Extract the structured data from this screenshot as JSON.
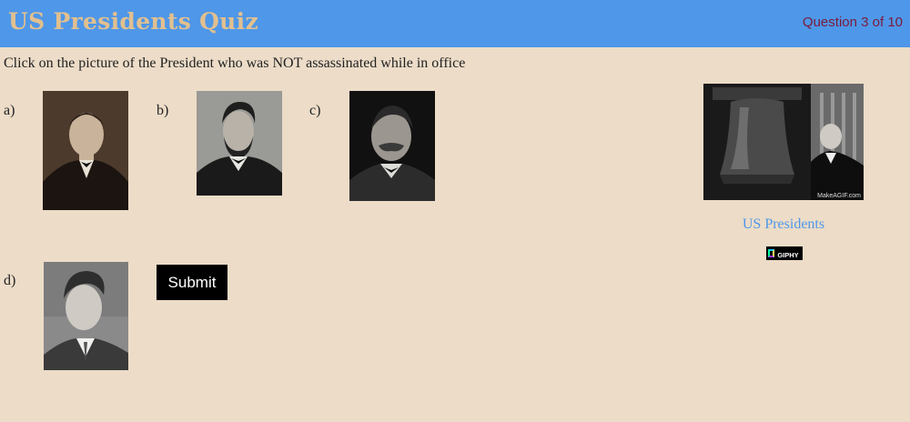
{
  "header": {
    "title": "US Presidents Quiz",
    "question_counter": "Question 3 of 10"
  },
  "question": {
    "prompt": "Click on the picture of the President who was NOT assassinated while in office"
  },
  "options": [
    {
      "label": "a)",
      "icon": "portrait-mckinley"
    },
    {
      "label": "b)",
      "icon": "portrait-lincoln"
    },
    {
      "label": "c)",
      "icon": "portrait-cleveland"
    },
    {
      "label": "d)",
      "icon": "portrait-kennedy"
    }
  ],
  "submit_label": "Submit",
  "sidebar": {
    "gif_watermark": "MakeAGIF.com",
    "gif_caption": "US Presidents",
    "badge_text": "GIPHY"
  },
  "colors": {
    "header_bg": "#4f97e8",
    "title": "#e2c08f",
    "counter": "#7a1c3c",
    "page_bg": "#ecdcc8",
    "link": "#4f97e8"
  }
}
